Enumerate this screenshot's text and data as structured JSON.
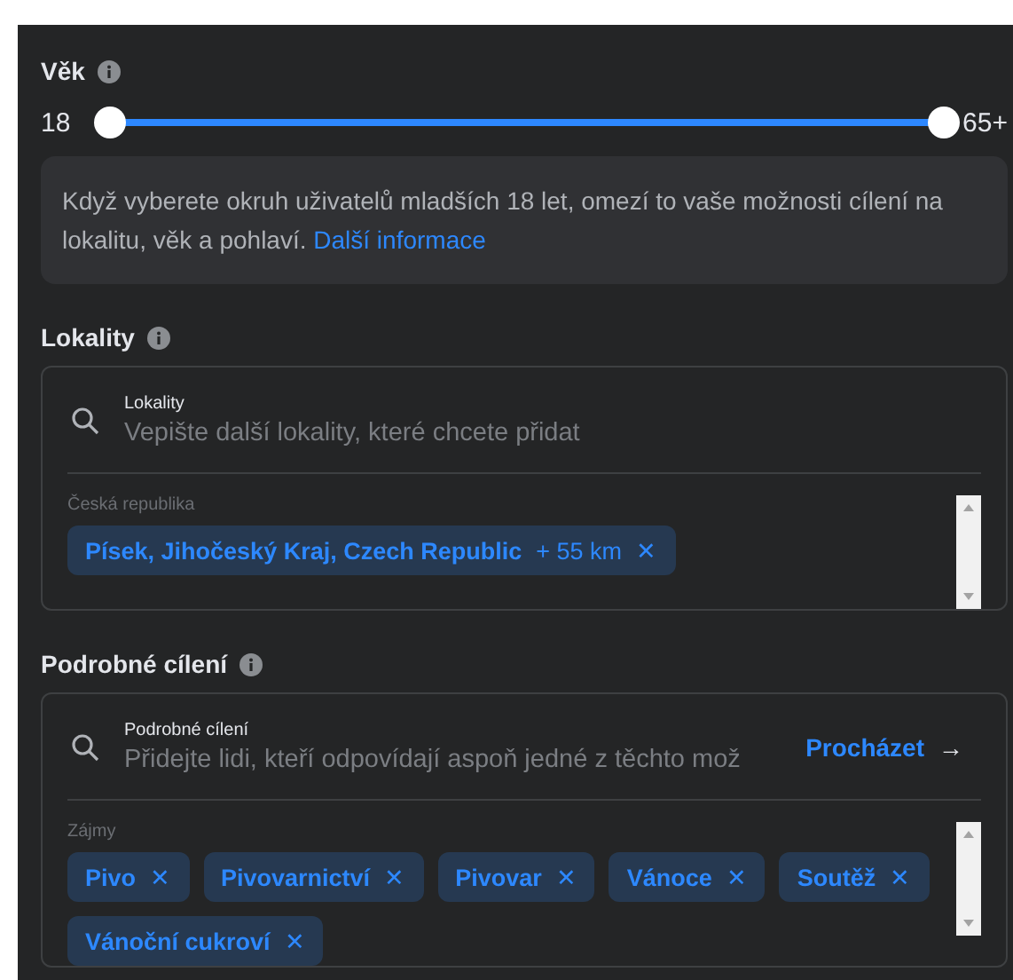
{
  "age": {
    "title": "Věk",
    "min_label": "18",
    "max_label": "65+",
    "thumbs": [
      {
        "level": 0
      },
      {
        "level": 1
      }
    ],
    "notice": "Když vyberete okruh uživatelů mladších 18 let, omezí to vaše možnosti cílení na lokalitu, věk a pohlaví.",
    "notice_link": "Další informace"
  },
  "locations": {
    "title": "Lokality",
    "field_label": "Lokality",
    "placeholder": "Vepište další lokality, které chcete přidat",
    "group": "Česká republika",
    "tags": [
      {
        "label": "Písek, Jihočeský Kraj, Czech Republic",
        "radius": "+ 55 km",
        "remove": "✕"
      }
    ]
  },
  "detailed": {
    "title": "Podrobné cílení",
    "field_label": "Podrobné cílení",
    "placeholder": "Přidejte lidi, kteří odpovídají aspoň jedné z těchto mož",
    "browse": "Procházet",
    "browse_arrow": "→",
    "group": "Zájmy",
    "tags": [
      {
        "label": "Pivo",
        "remove": "✕"
      },
      {
        "label": "Pivovarnictví",
        "remove": "✕"
      },
      {
        "label": "Pivovar",
        "remove": "✕"
      },
      {
        "label": "Vánoce",
        "remove": "✕"
      },
      {
        "label": "Soutěž",
        "remove": "✕"
      },
      {
        "label": "Vánoční cukroví",
        "remove": "✕"
      }
    ]
  }
}
